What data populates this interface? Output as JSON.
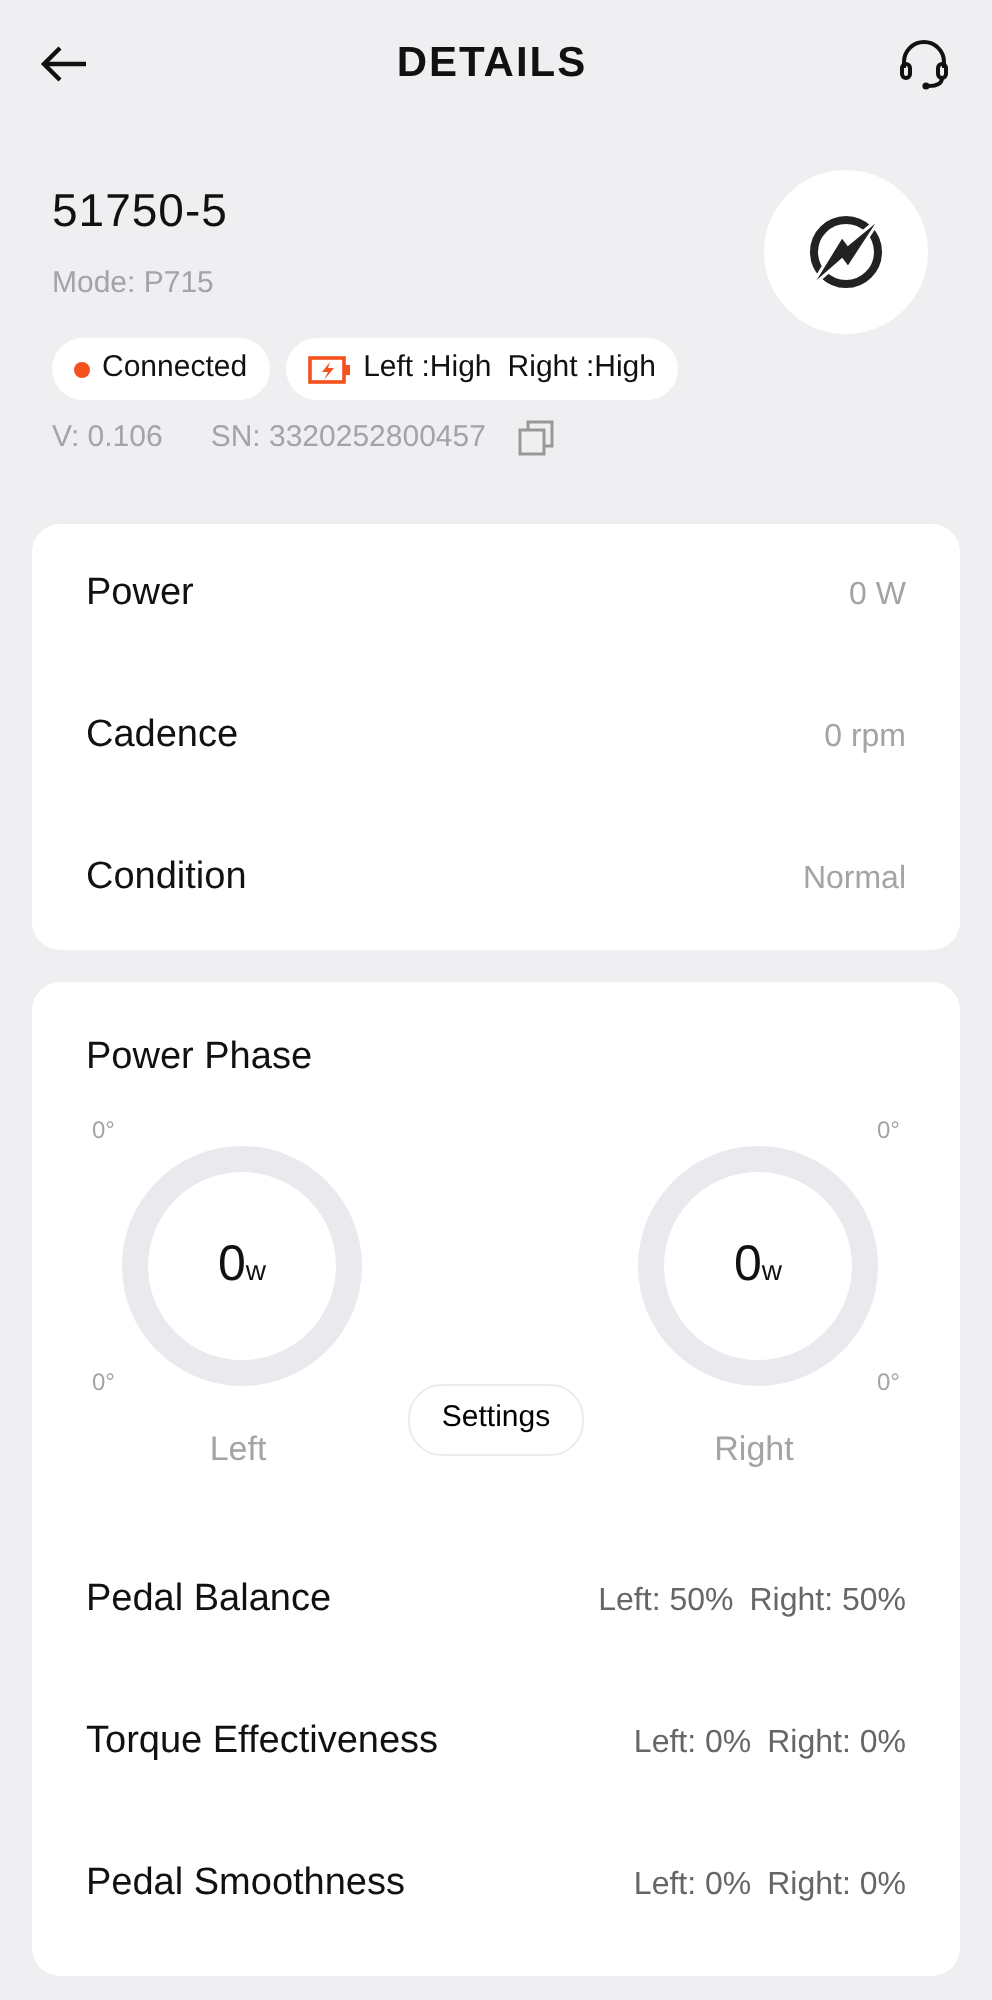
{
  "header": {
    "title": "DETAILS"
  },
  "device": {
    "name": "51750-5",
    "mode": "Mode: P715",
    "status": {
      "label": "Connected",
      "color": "#f4511e"
    },
    "battery": {
      "left": "Left :High",
      "right": "Right :High"
    },
    "version": "V: 0.106",
    "serial": "SN: 3320252800457"
  },
  "metrics": [
    {
      "label": "Power",
      "value": "0 W"
    },
    {
      "label": "Cadence",
      "value": "0 rpm"
    },
    {
      "label": "Condition",
      "value": "Normal"
    }
  ],
  "power_phase": {
    "title": "Power Phase",
    "settings_button": "Settings",
    "pedals": [
      {
        "label": "Left",
        "value": "0",
        "unit": "w",
        "top_angle": "0°",
        "bottom_angle": "0°"
      },
      {
        "label": "Right",
        "value": "0",
        "unit": "w",
        "top_angle": "0°",
        "bottom_angle": "0°"
      }
    ]
  },
  "stats": [
    {
      "label": "Pedal Balance",
      "left": "Left: 50%",
      "right": "Right: 50%"
    },
    {
      "label": "Torque Effectiveness",
      "left": "Left: 0%",
      "right": "Right: 0%"
    },
    {
      "label": "Pedal Smoothness",
      "left": "Left: 0%",
      "right": "Right: 0%"
    }
  ]
}
